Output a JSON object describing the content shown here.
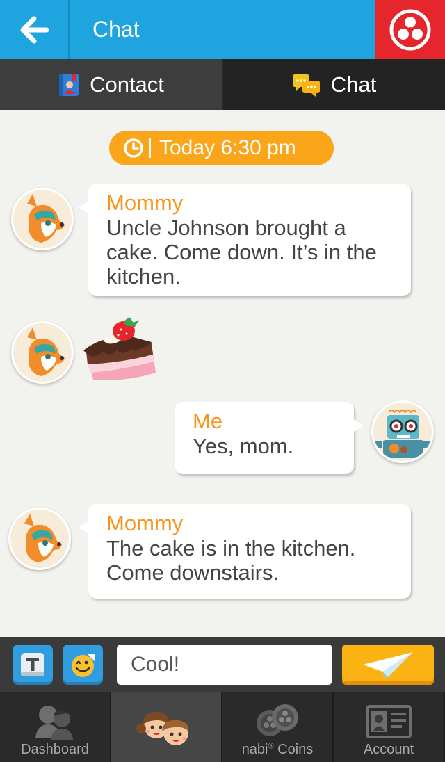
{
  "header": {
    "title": "Chat",
    "back_icon": "arrow-left-icon",
    "app_icon": "nabi-fan-icon",
    "colors": {
      "bar": "#1ea5e0",
      "app_button": "#e5262c"
    }
  },
  "tabs": [
    {
      "label": "Contact",
      "icon": "contact-book-icon"
    },
    {
      "label": "Chat",
      "icon": "chat-bubbles-icon"
    }
  ],
  "chat": {
    "timestamp": "Today 6:30 pm",
    "accent_color": "#fba51a",
    "messages": [
      {
        "sender": "Mommy",
        "text": "Uncle Johnson brought a cake. Come down. It’s in the kitchen.",
        "avatar": "deer-avatar"
      },
      {
        "sender": "Mommy",
        "sticker": "cake-slice-sticker",
        "avatar": "deer-avatar"
      },
      {
        "sender": "Me",
        "text": "Yes, mom.",
        "avatar": "robot-avatar"
      },
      {
        "sender": "Mommy",
        "text": "The cake is in the kitchen. Come downstairs.",
        "avatar": "deer-avatar"
      }
    ]
  },
  "composer": {
    "value": "Cool!",
    "keyboard_icon": "keyboard-t-icon",
    "emoji_icon": "emoji-sticker-icon",
    "send_icon": "paper-plane-icon"
  },
  "bottom_nav": {
    "dashboard": "Dashboard",
    "coins_brand": "nabi",
    "coins_mark": "®",
    "coins_suffix": " Coins",
    "account": "Account"
  }
}
